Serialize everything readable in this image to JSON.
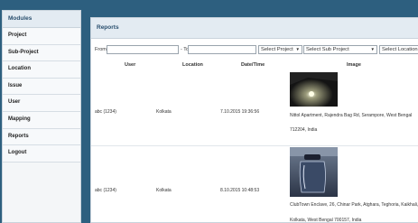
{
  "sidebar": {
    "title": "Modules",
    "items": [
      {
        "label": "Project"
      },
      {
        "label": "Sub-Project"
      },
      {
        "label": "Location"
      },
      {
        "label": "Issue"
      },
      {
        "label": "User"
      },
      {
        "label": "Mapping"
      },
      {
        "label": "Reports"
      },
      {
        "label": "Logout"
      }
    ]
  },
  "panel": {
    "title": "Reports"
  },
  "filters": {
    "from_label": "From",
    "to_label": "To",
    "from_value": "",
    "to_value": "",
    "project_select": "Select Project",
    "subproject_select": "Select Sub Project",
    "location_select": "Select Location"
  },
  "table": {
    "headers": {
      "user": "User",
      "location": "Location",
      "datetime": "Date/Time",
      "image": "Image"
    },
    "rows": [
      {
        "user": "abc (1234)",
        "location": "Kolkata",
        "datetime": "7.10.2015 19:36:56",
        "address_line1": "Nittol Apartment, Rajendra Bag Rd, Serampore, West Bengal",
        "address_line2": "712204, India"
      },
      {
        "user": "abc (1234)",
        "location": "Kolkata",
        "datetime": "8.10.2015 10:48:53",
        "address_line1": "ClubTown Enclave, 26, Chinar Park, Atghara, Teghoria, Kaikhali,",
        "address_line2": "Kolkata, West Bengal 700157, India"
      }
    ]
  },
  "colors": {
    "background": "#2d5f7f",
    "header_bg": "#e3ebf2",
    "header_text": "#2a4f6e"
  }
}
